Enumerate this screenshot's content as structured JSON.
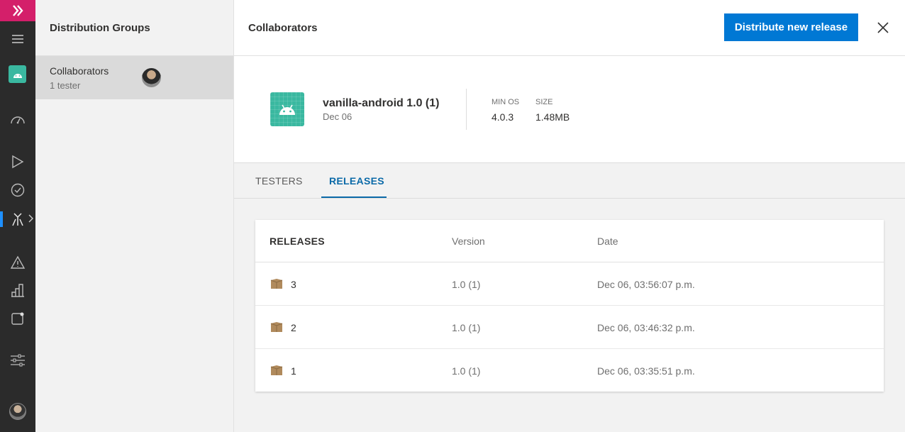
{
  "groups_panel": {
    "title": "Distribution Groups",
    "items": [
      {
        "name": "Collaborators",
        "subtitle": "1 tester"
      }
    ]
  },
  "header": {
    "title": "Collaborators",
    "primary_button": "Distribute new release"
  },
  "release": {
    "name": "vanilla-android 1.0 (1)",
    "date": "Dec 06",
    "min_os_label": "MIN OS",
    "min_os_value": "4.0.3",
    "size_label": "SIZE",
    "size_value": "1.48MB"
  },
  "tabs": [
    {
      "label": "TESTERS",
      "active": false
    },
    {
      "label": "RELEASES",
      "active": true
    }
  ],
  "releases_table": {
    "columns": [
      "RELEASES",
      "Version",
      "Date"
    ],
    "rows": [
      {
        "release": "3",
        "version": "1.0 (1)",
        "date": "Dec 06, 03:56:07 p.m."
      },
      {
        "release": "2",
        "version": "1.0 (1)",
        "date": "Dec 06, 03:46:32 p.m."
      },
      {
        "release": "1",
        "version": "1.0 (1)",
        "date": "Dec 06, 03:35:51 p.m."
      }
    ]
  },
  "colors": {
    "brand_pink": "#d41f6a",
    "primary_blue": "#0078d4",
    "android_teal": "#3ab8a0",
    "active_tab": "#0b6aa8"
  },
  "rail_icons": [
    "app-center-logo-icon",
    "menu-icon",
    "android-app-icon",
    "overview-gauge-icon",
    "build-icon",
    "test-icon",
    "distribute-icon",
    "diagnostics-icon",
    "analytics-icon",
    "push-icon",
    "settings-icon",
    "user-avatar"
  ]
}
